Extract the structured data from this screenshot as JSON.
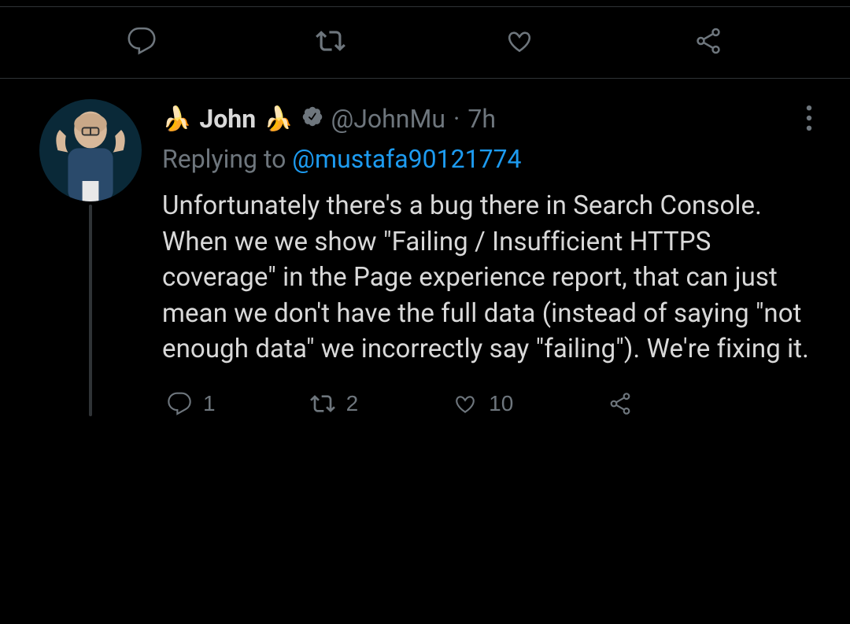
{
  "topActions": {
    "reply": "",
    "retweet": "",
    "like": "",
    "share": ""
  },
  "tweet": {
    "emojiLeft": "🍌",
    "displayName": "John",
    "emojiRight": "🍌",
    "handle": "@JohnMu",
    "separator": "·",
    "time": "7h",
    "replyingPrefix": "Replying to ",
    "replyingMention": "@mustafa90121774",
    "body": "Unfortunately there's a bug there in Search Console. When we we show \"Failing / Insufficient HTTPS coverage\" in the Page experience report, that can just mean we don't have the full data (instead of saying \"not enough data\" we incorrectly say \"failing\"). We're fixing it.",
    "actions": {
      "replies": "1",
      "retweets": "2",
      "likes": "10"
    }
  }
}
